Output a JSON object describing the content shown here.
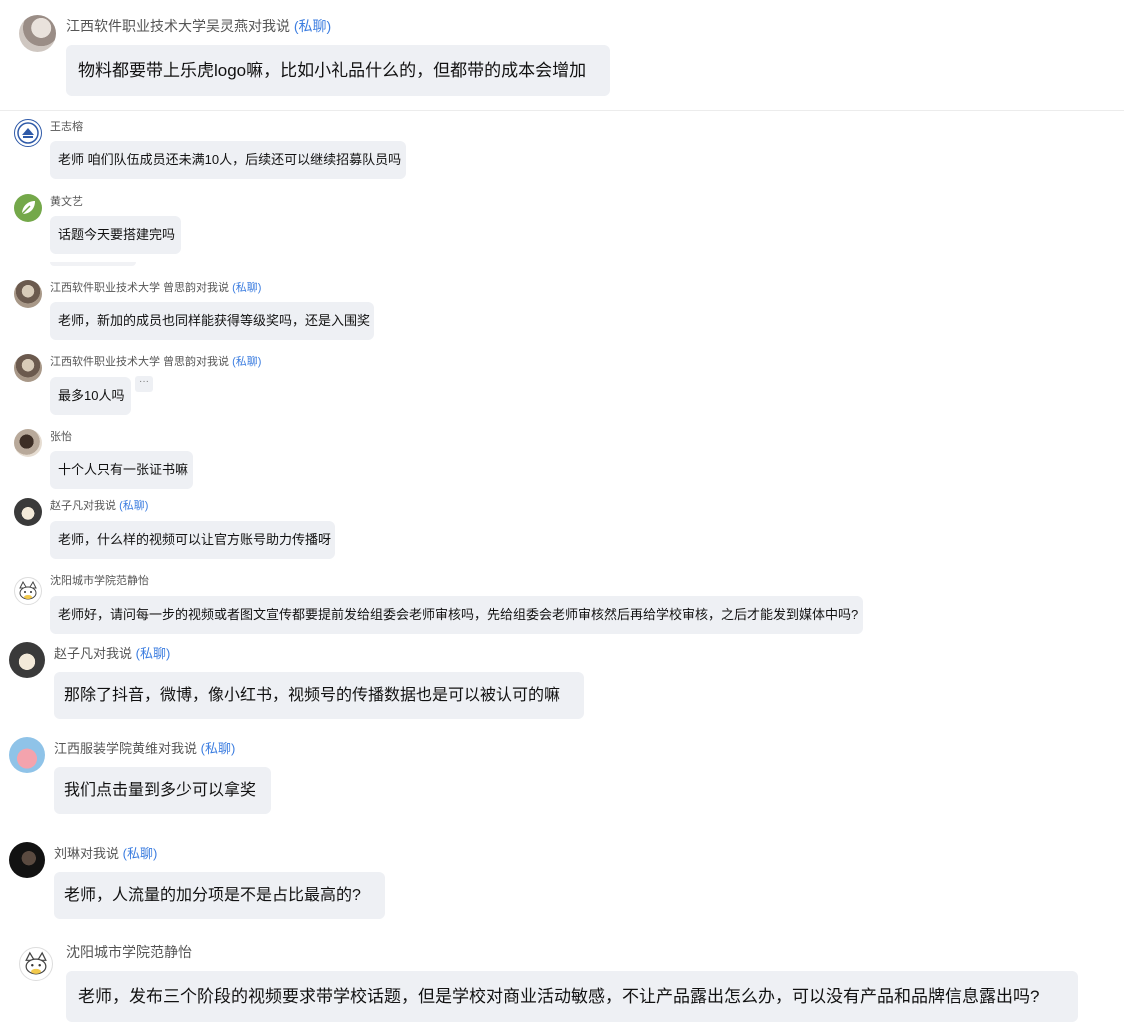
{
  "private_tag": "(私聊)",
  "more_label": "···",
  "messages": [
    {
      "sender": "江西软件职业技术大学吴灵燕对我说",
      "private": true,
      "text": "物料都要带上乐虎logo嘛，比如小礼品什么的，但都带的成本会增加",
      "avatar": "photo-avatar"
    },
    {
      "sender": "王志榕",
      "private": false,
      "text": "老师 咱们队伍成员还未满10人，后续还可以继续招募队员吗",
      "avatar": "school-logo-avatar"
    },
    {
      "sender": "黄文艺",
      "private": false,
      "text": "话题今天要搭建完吗",
      "avatar": "leaf-avatar"
    },
    {
      "sender": "江西软件职业技术大学 曾思韵对我说",
      "private": true,
      "text": "老师，新加的成员也同样能获得等级奖吗，还是入围奖",
      "avatar": "group-photo-avatar"
    },
    {
      "sender": "江西软件职业技术大学 曾思韵对我说",
      "private": true,
      "text": "最多10人吗",
      "avatar": "group-photo-avatar"
    },
    {
      "sender": "张怡",
      "private": false,
      "text": "十个人只有一张证书嘛",
      "avatar": "person-avatar"
    },
    {
      "sender": "赵子凡对我说",
      "private": true,
      "text": "老师，什么样的视频可以让官方账号助力传播呀",
      "avatar": "hands-avatar"
    },
    {
      "sender": "沈阳城市学院范静怡",
      "private": false,
      "text": "老师好，请问每一步的视频或者图文宣传都要提前发给组委会老师审核吗，先给组委会老师审核然后再给学校审核，之后才能发到媒体中吗?",
      "avatar": "cartoon-cat-avatar"
    },
    {
      "sender": "赵子凡对我说",
      "private": true,
      "text": "那除了抖音，微博，像小红书，视频号的传播数据也是可以被认可的嘛",
      "avatar": "hands-avatar"
    },
    {
      "sender": "江西服装学院黄维对我说",
      "private": true,
      "text": "我们点击量到多少可以拿奖",
      "avatar": "pig-avatar"
    },
    {
      "sender": "刘琳对我说",
      "private": true,
      "text": "老师，人流量的加分项是不是占比最高的?",
      "avatar": "dark-avatar"
    },
    {
      "sender": "沈阳城市学院范静怡",
      "private": false,
      "text": "老师，发布三个阶段的视频要求带学校话题，但是学校对商业活动敏感，不让产品露出怎么办，可以没有产品和品牌信息露出吗?",
      "avatar": "cartoon-cat-avatar"
    }
  ]
}
